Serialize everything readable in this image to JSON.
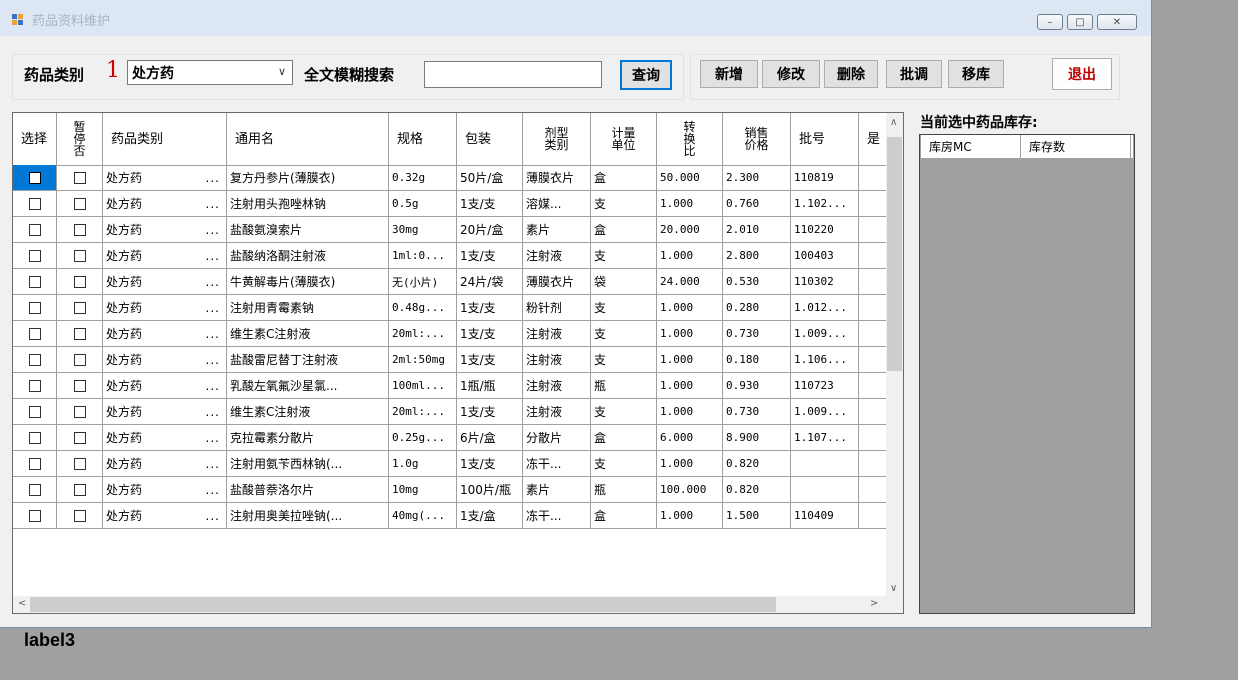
{
  "window": {
    "title": "药品资料维护"
  },
  "toolbar": {
    "category_label": "药品类别",
    "category_marker": "1",
    "category_value": "处方药",
    "search_label": "全文模糊搜索",
    "search_value": "",
    "query_label": "查询",
    "add_label": "新增",
    "edit_label": "修改",
    "delete_label": "删除",
    "price_adjust_label": "批调",
    "move_label": "移库",
    "exit_label": "退出"
  },
  "grid": {
    "columns": [
      "选择",
      "暂停否",
      "药品类别",
      "通用名",
      "规格",
      "包装",
      "剂型类别",
      "计量单位",
      "转换比",
      "销售价格",
      "批号",
      "是"
    ],
    "rows": [
      [
        "处方药",
        "复方丹参片(薄膜衣)",
        "0.32g",
        "50片/盒",
        "薄膜衣片",
        "盒",
        "50.000",
        "2.300",
        "110819"
      ],
      [
        "处方药",
        "注射用头孢唑林钠",
        "0.5g",
        "1支/支",
        "溶媒...",
        "支",
        "1.000",
        "0.760",
        "1.102..."
      ],
      [
        "处方药",
        "盐酸氨溴索片",
        "30mg",
        "20片/盒",
        "素片",
        "盒",
        "20.000",
        "2.010",
        "110220"
      ],
      [
        "处方药",
        "盐酸纳洛酮注射液",
        "1ml:0...",
        "1支/支",
        "注射液",
        "支",
        "1.000",
        "2.800",
        "100403"
      ],
      [
        "处方药",
        "牛黄解毒片(薄膜衣)",
        "无(小片)",
        "24片/袋",
        "薄膜衣片",
        "袋",
        "24.000",
        "0.530",
        "110302"
      ],
      [
        "处方药",
        "注射用青霉素钠",
        "0.48g...",
        "1支/支",
        "粉针剂",
        "支",
        "1.000",
        "0.280",
        "1.012..."
      ],
      [
        "处方药",
        "维生素C注射液",
        "20ml:...",
        "1支/支",
        "注射液",
        "支",
        "1.000",
        "0.730",
        "1.009..."
      ],
      [
        "处方药",
        "盐酸雷尼替丁注射液",
        "2ml:50mg",
        "1支/支",
        "注射液",
        "支",
        "1.000",
        "0.180",
        "1.106..."
      ],
      [
        "处方药",
        "乳酸左氧氟沙星氯...",
        "100ml...",
        "1瓶/瓶",
        "注射液",
        "瓶",
        "1.000",
        "0.930",
        "110723"
      ],
      [
        "处方药",
        "维生素C注射液",
        "20ml:...",
        "1支/支",
        "注射液",
        "支",
        "1.000",
        "0.730",
        "1.009..."
      ],
      [
        "处方药",
        "克拉霉素分散片",
        "0.25g...",
        "6片/盒",
        "分散片",
        "盒",
        "6.000",
        "8.900",
        "1.107..."
      ],
      [
        "处方药",
        "注射用氨苄西林钠(...",
        "1.0g",
        "1支/支",
        "冻干...",
        "支",
        "1.000",
        "0.820",
        ""
      ],
      [
        "处方药",
        "盐酸普萘洛尔片",
        "10mg",
        "100片/瓶",
        "素片",
        "瓶",
        "100.000",
        "0.820",
        ""
      ],
      [
        "处方药",
        "注射用奥美拉唑钠(...",
        "40mg(...",
        "1支/盒",
        "冻干...",
        "盒",
        "1.000",
        "1.500",
        "110409"
      ]
    ],
    "cell_ellipsis": "..."
  },
  "stock": {
    "title": "当前选中药品库存:",
    "columns": [
      "库房MC",
      "库存数"
    ]
  },
  "status": {
    "label3": "label3"
  }
}
